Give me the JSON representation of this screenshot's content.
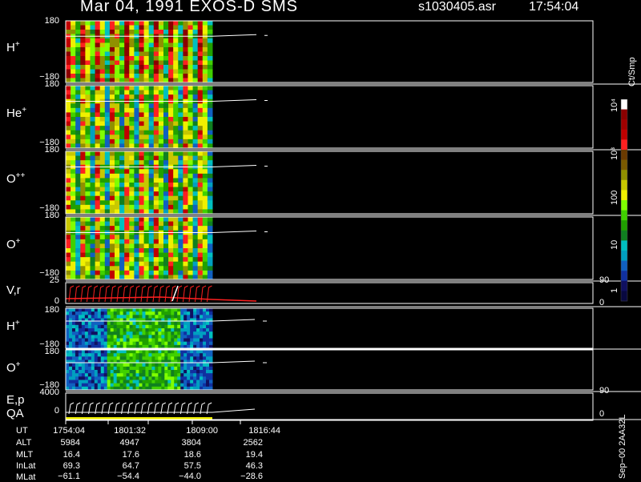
{
  "header": {
    "title": "Mar 04, 1991   EXOS-D SMS",
    "file": "s1030405.asr",
    "time": "17:54:04"
  },
  "panels": [
    {
      "label": "H",
      "sup": "+",
      "top_tick": "180",
      "bot_tick": "−180"
    },
    {
      "label": "He",
      "sup": "+",
      "top_tick": "180",
      "bot_tick": "−180"
    },
    {
      "label": "O",
      "sup": "++",
      "top_tick": "180",
      "bot_tick": "−180"
    },
    {
      "label": "O",
      "sup": "+",
      "top_tick": "180",
      "bot_tick": "−180"
    },
    {
      "label": "V,r",
      "sup": "",
      "top_tick": "25",
      "bot_tick": "0",
      "right_top": "90",
      "right_bot": "0"
    },
    {
      "label": "H",
      "sup": "+",
      "top_tick": "180",
      "bot_tick": "−180"
    },
    {
      "label": "O",
      "sup": "+",
      "top_tick": "180",
      "bot_tick": "−180"
    },
    {
      "label": "E,p",
      "sup": "",
      "label2": "QA",
      "top_tick": "4000",
      "bot_tick": "0",
      "right_top": "90",
      "right_bot": "0"
    }
  ],
  "ephemeris": {
    "rows": [
      {
        "name": "UT",
        "values": [
          "1754:04",
          "1801:32",
          "1809:00",
          "1816:44"
        ]
      },
      {
        "name": "ALT",
        "values": [
          "5984",
          "4947",
          "3804",
          "2562"
        ]
      },
      {
        "name": "MLT",
        "values": [
          "16.4",
          "17.6",
          "18.6",
          "19.4"
        ]
      },
      {
        "name": "InLat",
        "values": [
          "69.3",
          "64.7",
          "57.5",
          "46.3"
        ]
      },
      {
        "name": "MLat",
        "values": [
          "−61.1",
          "−54.4",
          "−44.0",
          "−28.6"
        ]
      }
    ]
  },
  "colorbar": {
    "unit": "Ct/Smp",
    "ticks": [
      "10⁴",
      "10³",
      "100",
      "10",
      "1"
    ],
    "colors": [
      "#ffffff",
      "#8b0000",
      "#a00000",
      "#c00000",
      "#ff2020",
      "#6b3a00",
      "#7a5a00",
      "#909000",
      "#c8c800",
      "#f0f000",
      "#80ff00",
      "#40d000",
      "#20a000",
      "#108020",
      "#00c0c0",
      "#00a0c0",
      "#1060c0",
      "#1030a0",
      "#101060",
      "#080840"
    ]
  },
  "footer": "Sep−00  2AA32L",
  "colors": {
    "background": "#000000",
    "axis": "#ffffff",
    "trace": "#ff2020",
    "qa": "#f0f000"
  },
  "chart_data": {
    "type": "heatmap",
    "title": "Mar 04, 1991   EXOS-D SMS",
    "x_ticks": [
      "1754:04",
      "1801:32",
      "1809:00",
      "1816:44"
    ],
    "panels": [
      {
        "label": "H+",
        "ylim": [
          -180,
          180
        ]
      },
      {
        "label": "He+",
        "ylim": [
          -180,
          180
        ]
      },
      {
        "label": "O++",
        "ylim": [
          -180,
          180
        ]
      },
      {
        "label": "O+",
        "ylim": [
          -180,
          180
        ]
      },
      {
        "label": "V,r",
        "ylim": [
          0,
          25
        ],
        "right_ylim": [
          0,
          90
        ]
      },
      {
        "label": "H+",
        "ylim": [
          -180,
          180
        ]
      },
      {
        "label": "O+",
        "ylim": [
          -180,
          180
        ]
      },
      {
        "label": "E,p QA",
        "ylim": [
          0,
          4000
        ],
        "right_ylim": [
          0,
          90
        ]
      }
    ],
    "colorbar_ticks": [
      "1",
      "10",
      "100",
      "10³",
      "10⁴"
    ],
    "colorbar_unit": "Ct/Smp"
  }
}
